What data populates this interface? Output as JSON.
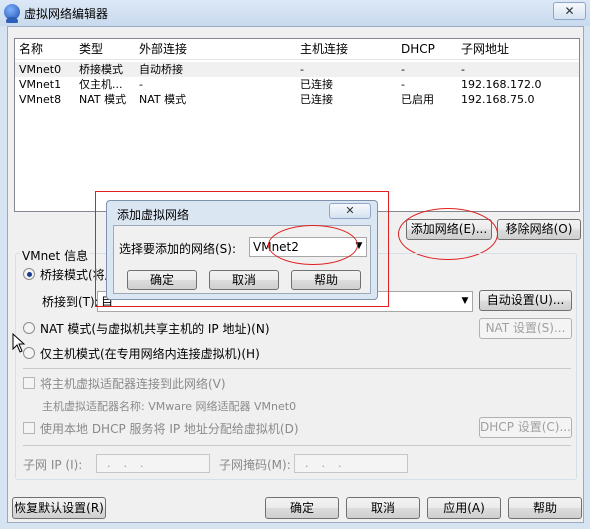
{
  "window": {
    "title": "虚拟网络编辑器",
    "close_glyph": "✕"
  },
  "table": {
    "headers": [
      "名称",
      "类型",
      "外部连接",
      "主机连接",
      "DHCP",
      "子网地址"
    ],
    "rows": [
      [
        "VMnet0",
        "桥接模式",
        "自动桥接",
        "-",
        "-",
        "-"
      ],
      [
        "VMnet1",
        "仅主机...",
        "-",
        "已连接",
        "-",
        "192.168.172.0"
      ],
      [
        "VMnet8",
        "NAT 模式",
        "NAT 模式",
        "已连接",
        "已启用",
        "192.168.75.0"
      ]
    ]
  },
  "buttons": {
    "add_network": "添加网络(E)...",
    "remove_network": "移除网络(O)",
    "auto_settings": "自动设置(U)...",
    "nat_settings": "NAT 设置(S)...",
    "dhcp_settings": "DHCP 设置(C)...",
    "restore_defaults": "恢复默认设置(R)",
    "ok": "确定",
    "cancel": "取消",
    "apply": "应用(A)",
    "help": "帮助"
  },
  "vmnet_info": {
    "group_label": "VMnet 信息",
    "bridged_label": "桥接模式(将虚",
    "bridge_to_label": "桥接到(T):",
    "bridge_to_value": "自",
    "nat_label": "NAT 模式(与虚拟机共享主机的 IP 地址)(N)",
    "host_only_label": "仅主机模式(在专用网络内连接虚拟机)(H)",
    "connect_adapter_label": "将主机虚拟适配器连接到此网络(V)",
    "adapter_name_label": "主机虚拟适配器名称: VMware 网络适配器 VMnet0",
    "use_dhcp_label": "使用本地 DHCP 服务将 IP 地址分配给虚拟机(D)",
    "subnet_ip_label": "子网 IP (I):",
    "subnet_mask_label": "子网掩码(M):",
    "ip_placeholder": "...",
    "bridged_checked": true
  },
  "add_dialog": {
    "title": "添加虚拟网络",
    "close_glyph": "✕",
    "select_label": "选择要添加的网络(S):",
    "selected_value": "VMnet2",
    "ok": "确定",
    "cancel": "取消",
    "help": "帮助"
  },
  "colors": {
    "annotation_red": "#e02020",
    "title_bar": "#c9daee"
  }
}
